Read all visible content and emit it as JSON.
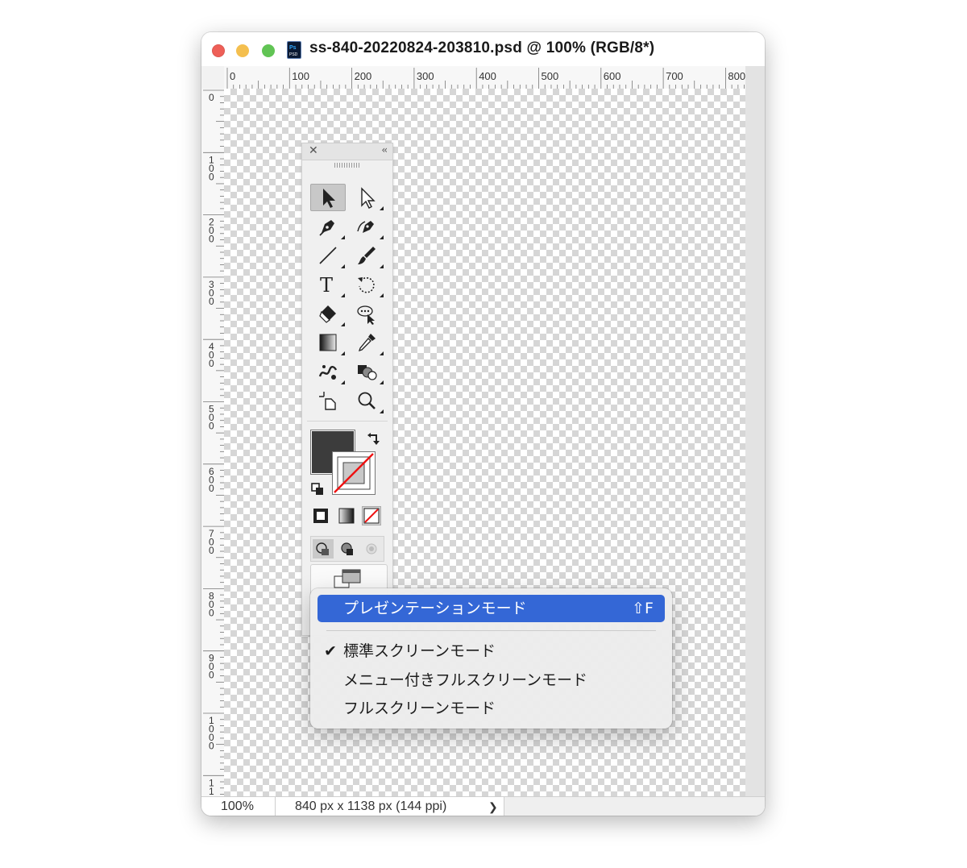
{
  "window": {
    "title": "ss-840-20220824-203810.psd @ 100% (RGB/8*)",
    "app_icon_text": "Ps",
    "app_icon_sub": "PSD"
  },
  "rulers": {
    "top_ticks": [
      "0",
      "100",
      "200",
      "300",
      "400",
      "500",
      "600",
      "700",
      "800"
    ],
    "left_ticks": [
      "0",
      "100",
      "200",
      "300",
      "400",
      "500",
      "600",
      "700",
      "800",
      "900",
      "1000",
      "11"
    ]
  },
  "status_bar": {
    "zoom": "100%",
    "doc_info": "840 px x 1138 px (144 ppi)",
    "arrow": "❯"
  },
  "toolbox": {
    "close": "✕",
    "collapse": "‹‹",
    "fill_color": "#3c3c3c",
    "stroke_color": "none",
    "tools": [
      "selection-tool",
      "direct-selection-tool",
      "pen-tool",
      "curvature-tool",
      "line-tool",
      "paintbrush-tool",
      "type-tool",
      "rotate-tool",
      "eraser-tool",
      "puppet-warp-tool",
      "gradient-tool",
      "eyedropper-tool",
      "symbol-sprayer-tool",
      "shape-builder-tool",
      "artboard-tool",
      "zoom-tool"
    ]
  },
  "context_menu": {
    "items": [
      {
        "label": "プレゼンテーションモード",
        "shortcut": "⇧F",
        "highlighted": true,
        "checked": false
      },
      {
        "label": "標準スクリーンモード",
        "shortcut": "",
        "highlighted": false,
        "checked": true
      },
      {
        "label": "メニュー付きフルスクリーンモード",
        "shortcut": "",
        "highlighted": false,
        "checked": false
      },
      {
        "label": "フルスクリーンモード",
        "shortcut": "",
        "highlighted": false,
        "checked": false
      }
    ],
    "check_mark": "✔",
    "highlight_color": "#3467d6"
  }
}
